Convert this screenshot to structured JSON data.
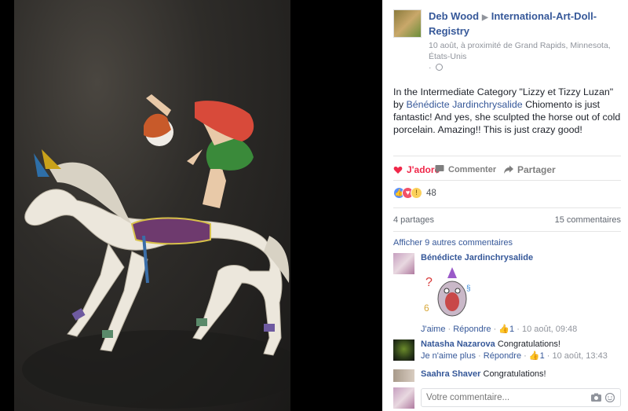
{
  "post": {
    "author": "Deb Wood",
    "group": "International-Art-Doll-Registry",
    "meta": "10 août, à proximité de Grand Rapids, Minnesota, États-Unis",
    "text_before": "In the Intermediate Category \"Lizzy et Tizzy Luzan\" by ",
    "text_link": "Bénédicte Jardinchrysalide",
    "text_after": " Chiomento is just fantastic! And yes, she sculpted the horse out of cold porcelain. Amazing!! This is just crazy good!"
  },
  "actions": {
    "like": "J'adore",
    "comment": "Commenter",
    "share": "Partager"
  },
  "reactions": {
    "count": "48",
    "icons": [
      "like-icon",
      "love-icon",
      "wow-icon"
    ]
  },
  "stats": {
    "shares": "4 partages",
    "comments": "15 commentaires"
  },
  "more_comments": "Afficher 9 autres commentaires",
  "comments": [
    {
      "name": "Bénédicte Jardinchrysalide",
      "text": "",
      "like_label": "J'aime",
      "reply_label": "Répondre",
      "likes": "1",
      "time": "10 août, 09:48",
      "sticker": "party-pig-sticker"
    },
    {
      "name": "Natasha Nazarova",
      "text": "Congratulations!",
      "like_label": "Je n'aime plus",
      "reply_label": "Répondre",
      "likes": "1",
      "time": "10 août, 13:43"
    },
    {
      "name": "Saahra Shaver",
      "text": "Congratulations!"
    }
  ],
  "composer": {
    "placeholder": "Votre commentaire..."
  },
  "colors": {
    "link": "#365899",
    "love": "#f0284a",
    "muted": "#90949c"
  }
}
